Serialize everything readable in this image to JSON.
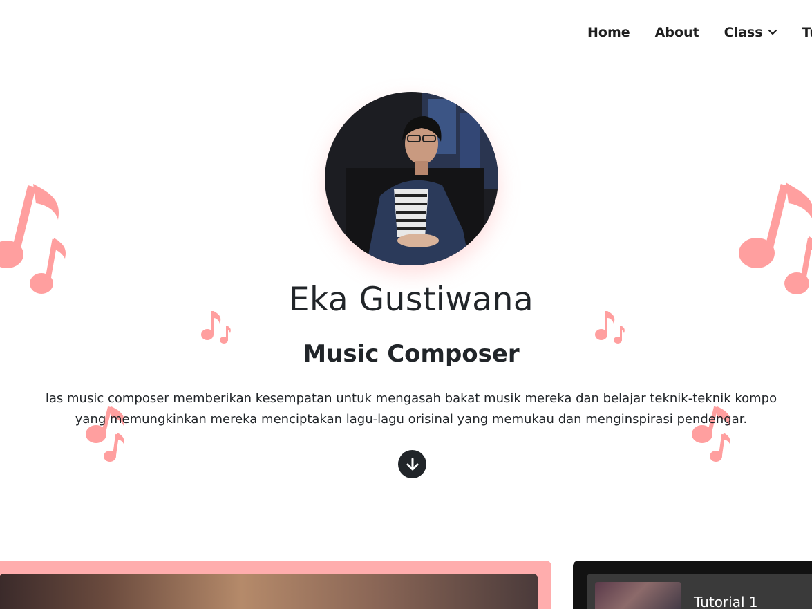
{
  "nav": {
    "items": [
      {
        "label": "Home"
      },
      {
        "label": "About"
      },
      {
        "label": "Class"
      },
      {
        "label": "Tu"
      }
    ]
  },
  "hero": {
    "name": "Eka Gustiwana",
    "role": "Music Composer",
    "description_line1": "las music composer memberikan kesempatan untuk mengasah bakat musik mereka dan belajar teknik-teknik kompo",
    "description_line2": "yang memungkinkan mereka menciptakan lagu-lagu orisinal yang memukau dan menginspirasi pendengar."
  },
  "tutorial": {
    "first_title": "Tutorial 1"
  },
  "icons": {
    "dropdown": "chevron-down-icon",
    "scroll": "arrow-down-circle-icon",
    "decoration": "music-note-icon"
  },
  "colors": {
    "accent_pink": "#ffadad",
    "note_pink": "#ff9f9f",
    "dark": "#212529",
    "card_dark": "#121212"
  }
}
